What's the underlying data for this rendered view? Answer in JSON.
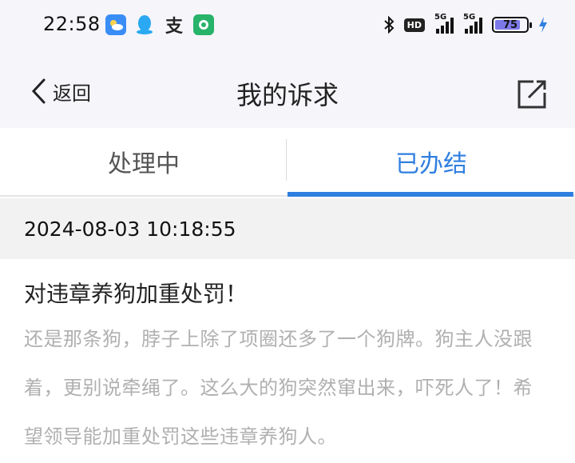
{
  "status_bar": {
    "time": "22:58",
    "hd_badge": "HD",
    "signal1": "5G",
    "signal2": "5G",
    "battery": "75"
  },
  "nav": {
    "back_label": "返回",
    "title": "我的诉求"
  },
  "tabs": [
    {
      "label": "处理中",
      "active": false
    },
    {
      "label": "已办结",
      "active": true
    }
  ],
  "record": {
    "datetime": "2024-08-03 10:18:55",
    "title": "对违章养狗加重处罚！",
    "content": "还是那条狗，脖子上除了项圈还多了一个狗牌。狗主人没跟着，更别说牵绳了。这么大的狗突然窜出来，吓死人了！希望领导能加重处罚这些违章养狗人。"
  },
  "colors": {
    "accent": "#2f7fe0",
    "header_bg": "#f6f5fa",
    "muted_text": "#b0b0b0"
  }
}
